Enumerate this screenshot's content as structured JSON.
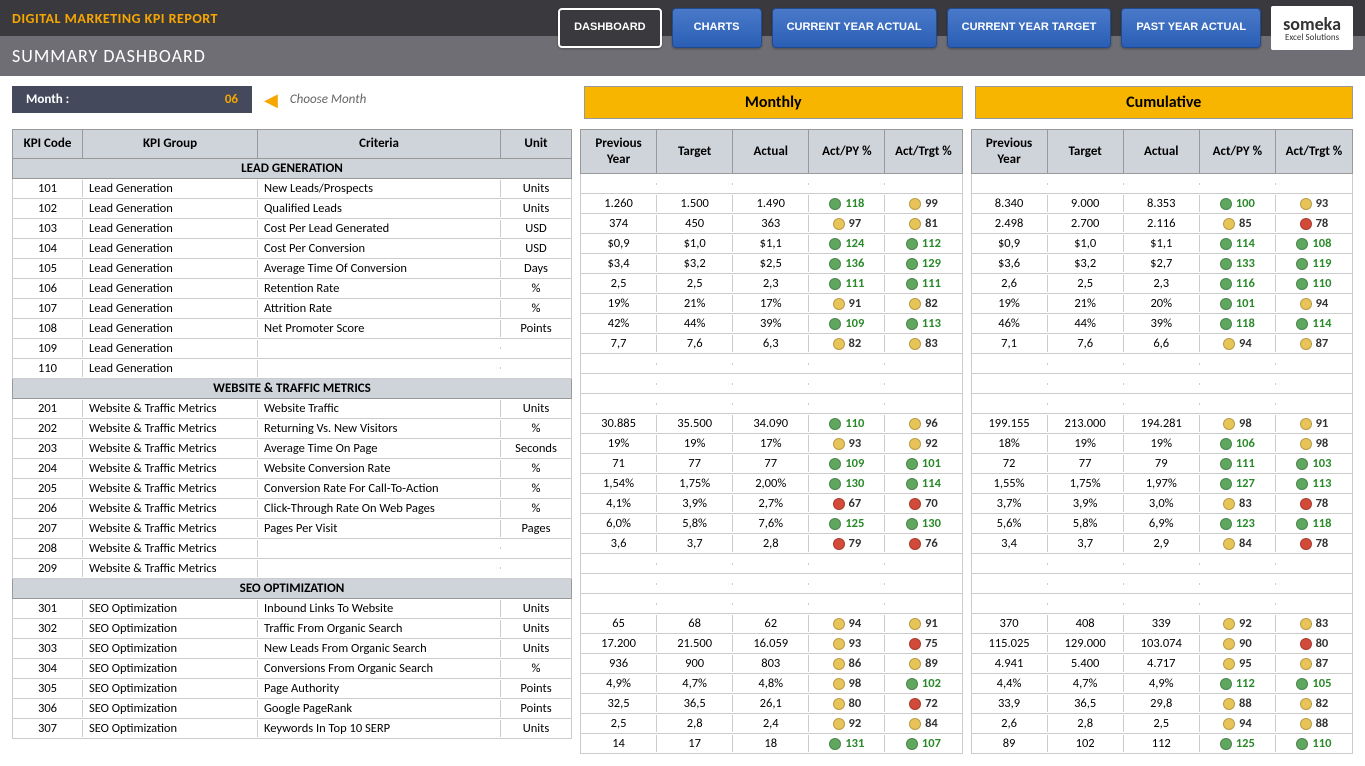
{
  "header": {
    "title": "DIGITAL MARKETING KPI REPORT",
    "subtitle": "SUMMARY DASHBOARD"
  },
  "nav": {
    "dashboard": "DASHBOARD",
    "charts": "CHARTS",
    "cy_actual": "CURRENT YEAR ACTUAL",
    "cy_target": "CURRENT YEAR TARGET",
    "py_actual": "PAST YEAR ACTUAL"
  },
  "logo": {
    "name": "someka",
    "sub": "Excel Solutions"
  },
  "month": {
    "label": "Month :",
    "value": "06",
    "hint": "Choose Month"
  },
  "leftCols": {
    "code": "KPI Code",
    "group": "KPI Group",
    "criteria": "Criteria",
    "unit": "Unit"
  },
  "blockCols": {
    "py": "Previous Year",
    "target": "Target",
    "actual": "Actual",
    "actpy": "Act/PY %",
    "acttgt": "Act/Trgt %"
  },
  "blocks": {
    "monthly": "Monthly",
    "cumulative": "Cumulative"
  },
  "groups": [
    {
      "title": "LEAD GENERATION",
      "rows": [
        {
          "code": "101",
          "group": "Lead Generation",
          "criteria": "New Leads/Prospects",
          "unit": "Units",
          "m": [
            "1.260",
            "1.500",
            "1.490",
            [
              "g",
              "118"
            ],
            [
              "y",
              "99"
            ]
          ],
          "c": [
            "8.340",
            "9.000",
            "8.353",
            [
              "g",
              "100"
            ],
            [
              "y",
              "93"
            ]
          ]
        },
        {
          "code": "102",
          "group": "Lead Generation",
          "criteria": "Qualified Leads",
          "unit": "Units",
          "m": [
            "374",
            "450",
            "363",
            [
              "y",
              "97"
            ],
            [
              "y",
              "81"
            ]
          ],
          "c": [
            "2.498",
            "2.700",
            "2.116",
            [
              "y",
              "85"
            ],
            [
              "r",
              "78"
            ]
          ]
        },
        {
          "code": "103",
          "group": "Lead Generation",
          "criteria": "Cost Per Lead Generated",
          "unit": "USD",
          "m": [
            "$0,9",
            "$1,0",
            "$1,1",
            [
              "g",
              "124"
            ],
            [
              "g",
              "112"
            ]
          ],
          "c": [
            "$0,9",
            "$1,0",
            "$1,1",
            [
              "g",
              "114"
            ],
            [
              "g",
              "108"
            ]
          ]
        },
        {
          "code": "104",
          "group": "Lead Generation",
          "criteria": "Cost Per Conversion",
          "unit": "USD",
          "m": [
            "$3,4",
            "$3,2",
            "$2,5",
            [
              "g",
              "136"
            ],
            [
              "g",
              "129"
            ]
          ],
          "c": [
            "$3,6",
            "$3,2",
            "$2,7",
            [
              "g",
              "133"
            ],
            [
              "g",
              "119"
            ]
          ]
        },
        {
          "code": "105",
          "group": "Lead Generation",
          "criteria": "Average Time Of Conversion",
          "unit": "Days",
          "m": [
            "2,5",
            "2,5",
            "2,3",
            [
              "g",
              "111"
            ],
            [
              "g",
              "111"
            ]
          ],
          "c": [
            "2,6",
            "2,5",
            "2,3",
            [
              "g",
              "116"
            ],
            [
              "g",
              "110"
            ]
          ]
        },
        {
          "code": "106",
          "group": "Lead Generation",
          "criteria": "Retention Rate",
          "unit": "%",
          "m": [
            "19%",
            "21%",
            "17%",
            [
              "y",
              "91"
            ],
            [
              "y",
              "82"
            ]
          ],
          "c": [
            "19%",
            "21%",
            "20%",
            [
              "g",
              "101"
            ],
            [
              "y",
              "94"
            ]
          ]
        },
        {
          "code": "107",
          "group": "Lead Generation",
          "criteria": "Attrition Rate",
          "unit": "%",
          "m": [
            "42%",
            "44%",
            "39%",
            [
              "g",
              "109"
            ],
            [
              "g",
              "113"
            ]
          ],
          "c": [
            "46%",
            "44%",
            "39%",
            [
              "g",
              "118"
            ],
            [
              "g",
              "114"
            ]
          ]
        },
        {
          "code": "108",
          "group": "Lead Generation",
          "criteria": "Net Promoter Score",
          "unit": "Points",
          "m": [
            "7,7",
            "7,6",
            "6,3",
            [
              "y",
              "82"
            ],
            [
              "y",
              "83"
            ]
          ],
          "c": [
            "7,1",
            "7,6",
            "6,6",
            [
              "y",
              "94"
            ],
            [
              "y",
              "87"
            ]
          ]
        },
        {
          "code": "109",
          "group": "Lead Generation",
          "criteria": "",
          "unit": "",
          "m": [
            "",
            "",
            "",
            "",
            ""
          ],
          "c": [
            "",
            "",
            "",
            "",
            ""
          ]
        },
        {
          "code": "110",
          "group": "Lead Generation",
          "criteria": "",
          "unit": "",
          "m": [
            "",
            "",
            "",
            "",
            ""
          ],
          "c": [
            "",
            "",
            "",
            "",
            ""
          ]
        }
      ]
    },
    {
      "title": "WEBSITE & TRAFFIC METRICS",
      "rows": [
        {
          "code": "201",
          "group": "Website & Traffic Metrics",
          "criteria": "Website Traffic",
          "unit": "Units",
          "m": [
            "30.885",
            "35.500",
            "34.090",
            [
              "g",
              "110"
            ],
            [
              "y",
              "96"
            ]
          ],
          "c": [
            "199.155",
            "213.000",
            "194.281",
            [
              "y",
              "98"
            ],
            [
              "y",
              "91"
            ]
          ]
        },
        {
          "code": "202",
          "group": "Website & Traffic Metrics",
          "criteria": "Returning Vs. New Visitors",
          "unit": "%",
          "m": [
            "19%",
            "19%",
            "17%",
            [
              "y",
              "93"
            ],
            [
              "y",
              "92"
            ]
          ],
          "c": [
            "18%",
            "19%",
            "19%",
            [
              "g",
              "106"
            ],
            [
              "y",
              "98"
            ]
          ]
        },
        {
          "code": "203",
          "group": "Website & Traffic Metrics",
          "criteria": "Average Time On Page",
          "unit": "Seconds",
          "m": [
            "71",
            "77",
            "77",
            [
              "g",
              "109"
            ],
            [
              "g",
              "101"
            ]
          ],
          "c": [
            "72",
            "77",
            "79",
            [
              "g",
              "111"
            ],
            [
              "g",
              "103"
            ]
          ]
        },
        {
          "code": "204",
          "group": "Website & Traffic Metrics",
          "criteria": "Website Conversion Rate",
          "unit": "%",
          "m": [
            "1,54%",
            "1,75%",
            "2,00%",
            [
              "g",
              "130"
            ],
            [
              "g",
              "114"
            ]
          ],
          "c": [
            "1,55%",
            "1,75%",
            "1,97%",
            [
              "g",
              "127"
            ],
            [
              "g",
              "113"
            ]
          ]
        },
        {
          "code": "205",
          "group": "Website & Traffic Metrics",
          "criteria": "Conversion Rate For Call-To-Action",
          "unit": "%",
          "m": [
            "4,1%",
            "3,9%",
            "2,7%",
            [
              "r",
              "67"
            ],
            [
              "r",
              "70"
            ]
          ],
          "c": [
            "3,7%",
            "3,9%",
            "3,0%",
            [
              "y",
              "83"
            ],
            [
              "r",
              "78"
            ]
          ]
        },
        {
          "code": "206",
          "group": "Website & Traffic Metrics",
          "criteria": "Click-Through Rate On Web Pages",
          "unit": "%",
          "m": [
            "6,0%",
            "5,8%",
            "7,6%",
            [
              "g",
              "125"
            ],
            [
              "g",
              "130"
            ]
          ],
          "c": [
            "5,6%",
            "5,8%",
            "6,9%",
            [
              "g",
              "123"
            ],
            [
              "g",
              "118"
            ]
          ]
        },
        {
          "code": "207",
          "group": "Website & Traffic Metrics",
          "criteria": "Pages Per Visit",
          "unit": "Pages",
          "m": [
            "3,6",
            "3,7",
            "2,8",
            [
              "r",
              "79"
            ],
            [
              "r",
              "76"
            ]
          ],
          "c": [
            "3,4",
            "3,7",
            "2,9",
            [
              "y",
              "84"
            ],
            [
              "r",
              "78"
            ]
          ]
        },
        {
          "code": "208",
          "group": "Website & Traffic Metrics",
          "criteria": "",
          "unit": "",
          "m": [
            "",
            "",
            "",
            "",
            ""
          ],
          "c": [
            "",
            "",
            "",
            "",
            ""
          ]
        },
        {
          "code": "209",
          "group": "Website & Traffic Metrics",
          "criteria": "",
          "unit": "",
          "m": [
            "",
            "",
            "",
            "",
            ""
          ],
          "c": [
            "",
            "",
            "",
            "",
            ""
          ]
        }
      ]
    },
    {
      "title": "SEO OPTIMIZATION",
      "rows": [
        {
          "code": "301",
          "group": "SEO Optimization",
          "criteria": "Inbound Links To Website",
          "unit": "Units",
          "m": [
            "65",
            "68",
            "62",
            [
              "y",
              "94"
            ],
            [
              "y",
              "91"
            ]
          ],
          "c": [
            "370",
            "408",
            "339",
            [
              "y",
              "92"
            ],
            [
              "y",
              "83"
            ]
          ]
        },
        {
          "code": "302",
          "group": "SEO Optimization",
          "criteria": "Traffic From Organic Search",
          "unit": "Units",
          "m": [
            "17.200",
            "21.500",
            "16.059",
            [
              "y",
              "93"
            ],
            [
              "r",
              "75"
            ]
          ],
          "c": [
            "115.025",
            "129.000",
            "103.074",
            [
              "y",
              "90"
            ],
            [
              "r",
              "80"
            ]
          ]
        },
        {
          "code": "303",
          "group": "SEO Optimization",
          "criteria": "New Leads From Organic Search",
          "unit": "Units",
          "m": [
            "936",
            "900",
            "803",
            [
              "y",
              "86"
            ],
            [
              "y",
              "89"
            ]
          ],
          "c": [
            "4.941",
            "5.400",
            "4.717",
            [
              "y",
              "95"
            ],
            [
              "y",
              "87"
            ]
          ]
        },
        {
          "code": "304",
          "group": "SEO Optimization",
          "criteria": "Conversions From Organic Search",
          "unit": "%",
          "m": [
            "4,9%",
            "4,7%",
            "4,8%",
            [
              "y",
              "98"
            ],
            [
              "g",
              "102"
            ]
          ],
          "c": [
            "4,4%",
            "4,7%",
            "4,9%",
            [
              "g",
              "112"
            ],
            [
              "g",
              "105"
            ]
          ]
        },
        {
          "code": "305",
          "group": "SEO Optimization",
          "criteria": "Page Authority",
          "unit": "Points",
          "m": [
            "32,5",
            "36,5",
            "26,1",
            [
              "y",
              "80"
            ],
            [
              "r",
              "72"
            ]
          ],
          "c": [
            "33,9",
            "36,5",
            "29,8",
            [
              "y",
              "88"
            ],
            [
              "y",
              "82"
            ]
          ]
        },
        {
          "code": "306",
          "group": "SEO Optimization",
          "criteria": "Google PageRank",
          "unit": "Points",
          "m": [
            "2,5",
            "2,8",
            "2,4",
            [
              "y",
              "92"
            ],
            [
              "y",
              "84"
            ]
          ],
          "c": [
            "2,6",
            "2,8",
            "2,5",
            [
              "y",
              "94"
            ],
            [
              "y",
              "88"
            ]
          ]
        },
        {
          "code": "307",
          "group": "SEO Optimization",
          "criteria": "Keywords In Top 10 SERP",
          "unit": "Units",
          "m": [
            "14",
            "17",
            "18",
            [
              "g",
              "131"
            ],
            [
              "g",
              "107"
            ]
          ],
          "c": [
            "89",
            "102",
            "112",
            [
              "g",
              "125"
            ],
            [
              "g",
              "110"
            ]
          ]
        }
      ]
    }
  ]
}
